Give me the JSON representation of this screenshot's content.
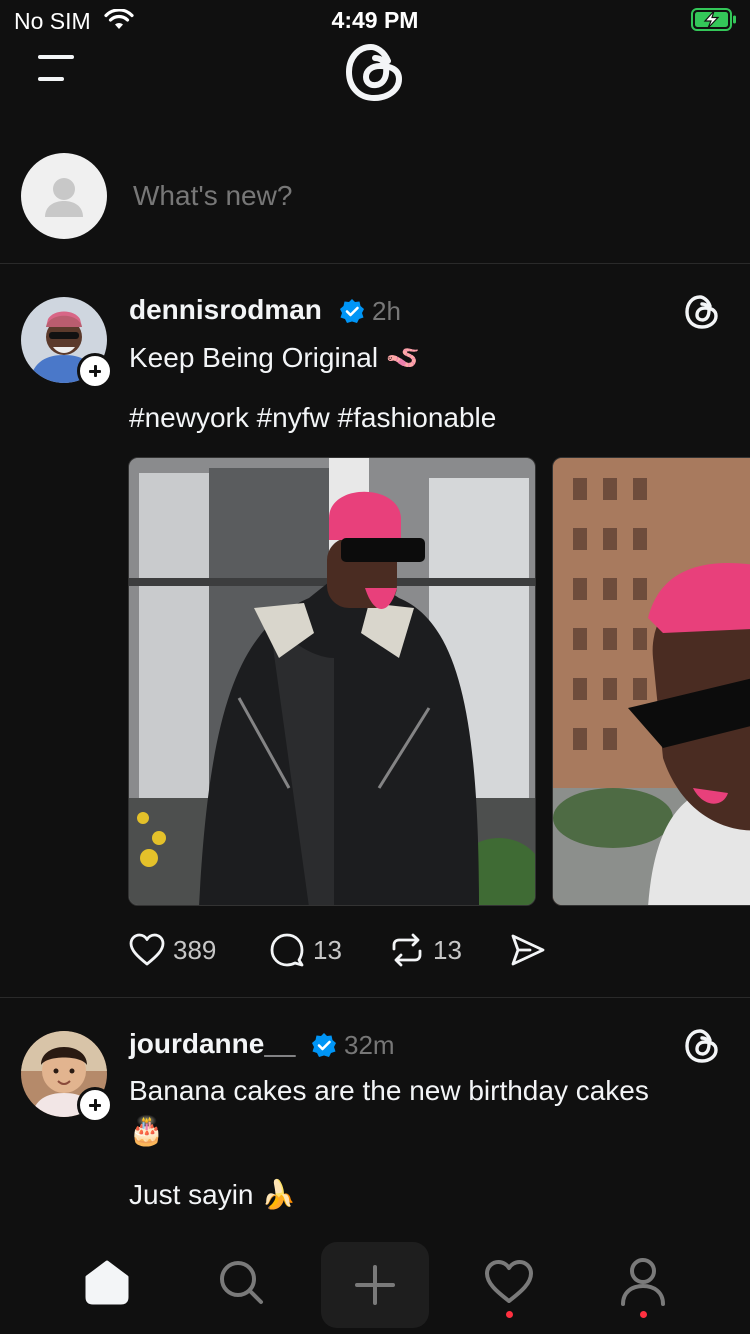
{
  "status_bar": {
    "carrier": "No SIM",
    "time": "4:49 PM",
    "battery_color": "#34c759"
  },
  "top_bar": {
    "menu_icon": "hamburger-menu-icon",
    "logo_icon": "threads-logo-icon"
  },
  "composer": {
    "placeholder": "What's new?"
  },
  "posts": [
    {
      "username": "dennisrodman",
      "verified": true,
      "time": "2h",
      "text": "Keep Being Original 🪱",
      "hashtags": "#newyork #nyfw #fashionable",
      "likes": "389",
      "comments": "13",
      "reposts": "13"
    },
    {
      "username": "jourdanne__",
      "verified": true,
      "time": "32m",
      "text_line1": "Banana cakes are the new birthday cakes",
      "text_line2": "🎂",
      "text_line3": "Just sayin 🍌"
    }
  ],
  "tabbar": {
    "tabs": [
      "home-icon",
      "search-icon",
      "create-icon",
      "activity-icon",
      "profile-icon"
    ],
    "active": "home",
    "notification_color": "#ff3040"
  },
  "colors": {
    "background": "#101010",
    "text": "#f3f5f7",
    "muted": "#777777",
    "verified": "#0095f6"
  }
}
